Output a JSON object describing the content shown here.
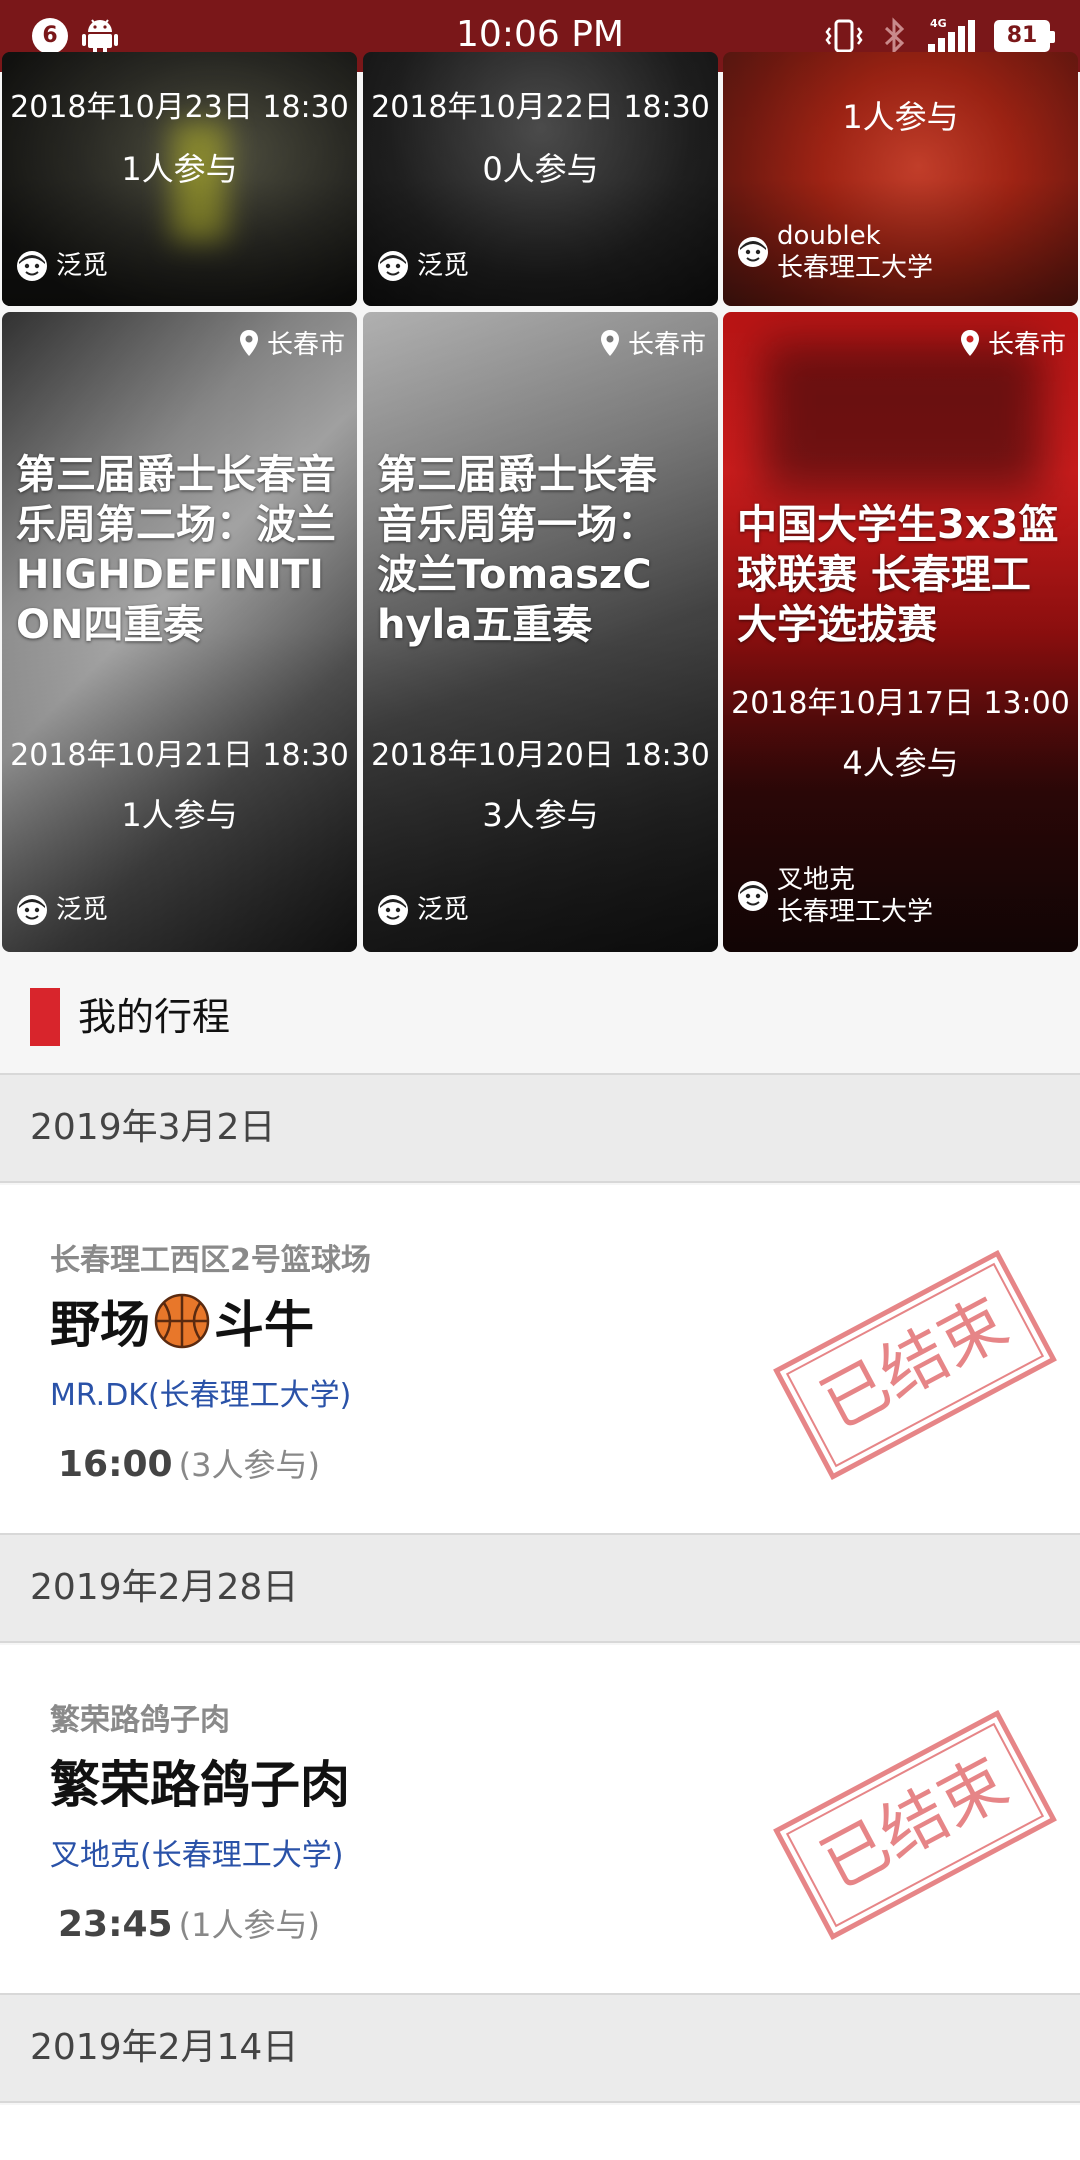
{
  "status_bar": {
    "notification_count": "6",
    "time": "10:06 PM",
    "network": "4G",
    "battery": "81"
  },
  "events": [
    {
      "date": "2018年10月23日 18:30",
      "participants": "1人参与",
      "author": "泛觅"
    },
    {
      "date": "2018年10月22日 18:30",
      "participants": "0人参与",
      "author": "泛觅"
    },
    {
      "participants": "1人参与",
      "author_name": "doublek",
      "author_org": "长春理工大学"
    },
    {
      "location": "长春市",
      "title": "第三届爵士长春音乐周第二场：波兰HIGHDEFINITION四重奏",
      "date": "2018年10月21日 18:30",
      "participants": "1人参与",
      "author": "泛觅"
    },
    {
      "location": "长春市",
      "title": "第三届爵士长春音乐周第一场：波兰TomaszChyla五重奏",
      "date": "2018年10月20日 18:30",
      "participants": "3人参与",
      "author": "泛觅"
    },
    {
      "location": "长春市",
      "title": "中国大学生3x3篮球联赛 长春理工大学选拔赛",
      "date": "2018年10月17日 13:00",
      "participants": "4人参与",
      "author_name": "叉地克",
      "author_org": "长春理工大学"
    }
  ],
  "itinerary": {
    "heading": "我的行程",
    "days": [
      {
        "date": "2019年3月2日",
        "venue": "长春理工西区2号篮球场",
        "name_before": "野场",
        "name_after": "斗牛",
        "host": "MR.DK(长春理工大学)",
        "time": "16:00",
        "count": "(3人参与)",
        "stamp": "已结束"
      },
      {
        "date": "2019年2月28日",
        "venue": "繁荣路鸽子肉",
        "name": "繁荣路鸽子肉",
        "host": "叉地克(长春理工大学)",
        "time": "23:45",
        "count": "(1人参与)",
        "stamp": "已结束"
      },
      {
        "date": "2019年2月14日"
      }
    ]
  },
  "colors": {
    "status_bar": "#7a1719",
    "accent": "#d8252c",
    "host_link": "#2a52a8",
    "stamp": "#e0676a"
  }
}
